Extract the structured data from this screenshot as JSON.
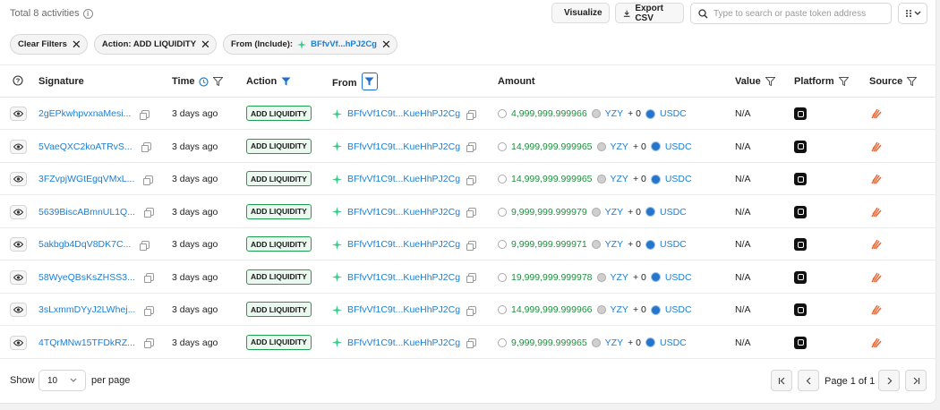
{
  "header": {
    "total_label": "Total 8 activities",
    "visualize_label": "Visualize",
    "export_label": "Export CSV",
    "search_placeholder": "Type to search or paste token address"
  },
  "filters": {
    "clear_label": "Clear Filters",
    "action_chip": "Action: ADD LIQUIDITY",
    "from_chip_prefix": "From (Include):",
    "from_chip_addr": "BFfvVf...hPJ2Cg"
  },
  "columns": {
    "signature": "Signature",
    "time": "Time",
    "action": "Action",
    "from": "From",
    "amount": "Amount",
    "value": "Value",
    "platform": "Platform",
    "source": "Source"
  },
  "colors": {
    "link": "#1a7fd6",
    "amount": "#1e8e3e",
    "badge_border": "#1e9e4e",
    "filter_active": "#1f6fd1"
  },
  "rows": [
    {
      "sig": "2gEPkwhpvxnaMesi...",
      "time": "3 days ago",
      "action": "ADD LIQUIDITY",
      "from": "BFfvVf1C9t...KueHhPJ2Cg",
      "amount": "4,999,999.999966",
      "token1": "YZY",
      "plus": "+ 0",
      "token2": "USDC",
      "value": "N/A"
    },
    {
      "sig": "5VaeQXC2koATRvS...",
      "time": "3 days ago",
      "action": "ADD LIQUIDITY",
      "from": "BFfvVf1C9t...KueHhPJ2Cg",
      "amount": "14,999,999.999965",
      "token1": "YZY",
      "plus": "+ 0",
      "token2": "USDC",
      "value": "N/A"
    },
    {
      "sig": "3FZvpjWGtEgqVMxL...",
      "time": "3 days ago",
      "action": "ADD LIQUIDITY",
      "from": "BFfvVf1C9t...KueHhPJ2Cg",
      "amount": "14,999,999.999965",
      "token1": "YZY",
      "plus": "+ 0",
      "token2": "USDC",
      "value": "N/A"
    },
    {
      "sig": "5639BiscABmnUL1Q...",
      "time": "3 days ago",
      "action": "ADD LIQUIDITY",
      "from": "BFfvVf1C9t...KueHhPJ2Cg",
      "amount": "9,999,999.999979",
      "token1": "YZY",
      "plus": "+ 0",
      "token2": "USDC",
      "value": "N/A"
    },
    {
      "sig": "5akbgb4DqV8DK7C...",
      "time": "3 days ago",
      "action": "ADD LIQUIDITY",
      "from": "BFfvVf1C9t...KueHhPJ2Cg",
      "amount": "9,999,999.999971",
      "token1": "YZY",
      "plus": "+ 0",
      "token2": "USDC",
      "value": "N/A"
    },
    {
      "sig": "58WyeQBsKsZHSS3...",
      "time": "3 days ago",
      "action": "ADD LIQUIDITY",
      "from": "BFfvVf1C9t...KueHhPJ2Cg",
      "amount": "19,999,999.999978",
      "token1": "YZY",
      "plus": "+ 0",
      "token2": "USDC",
      "value": "N/A"
    },
    {
      "sig": "3sLxmmDYyJ2LWhej...",
      "time": "3 days ago",
      "action": "ADD LIQUIDITY",
      "from": "BFfvVf1C9t...KueHhPJ2Cg",
      "amount": "14,999,999.999966",
      "token1": "YZY",
      "plus": "+ 0",
      "token2": "USDC",
      "value": "N/A"
    },
    {
      "sig": "4TQrMNw15TFDkRZ...",
      "time": "3 days ago",
      "action": "ADD LIQUIDITY",
      "from": "BFfvVf1C9t...KueHhPJ2Cg",
      "amount": "9,999,999.999965",
      "token1": "YZY",
      "plus": "+ 0",
      "token2": "USDC",
      "value": "N/A"
    }
  ],
  "footer": {
    "show_label": "Show",
    "per_page_value": "10",
    "per_page_label": "per page",
    "page_label": "Page 1 of 1"
  }
}
